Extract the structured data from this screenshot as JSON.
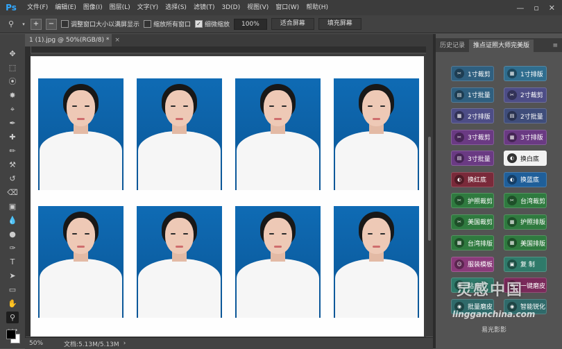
{
  "app": {
    "logo": "Ps"
  },
  "menu": [
    "文件(F)",
    "编辑(E)",
    "图像(I)",
    "图层(L)",
    "文字(Y)",
    "选择(S)",
    "滤镜(T)",
    "3D(D)",
    "视图(V)",
    "窗口(W)",
    "帮助(H)"
  ],
  "window_controls": {
    "minimize": "—",
    "restore": "▫",
    "close": "✕"
  },
  "options": {
    "zoom_in": "+",
    "zoom_out": "−",
    "resize_windows": "调整窗口大小以满屏显示",
    "zoom_all_windows": "缩放所有窗口",
    "scrubby_zoom": "细微缩放",
    "zoom_value": "100%",
    "fit_screen": "适合屏幕",
    "fill_screen": "填充屏幕"
  },
  "document": {
    "tab_title": "1 (1).jpg @ 50%(RGB/8) *",
    "close": "×"
  },
  "status": {
    "zoom": "50%",
    "doc_size": "文档:5.13M/5.13M",
    "arrow": "›"
  },
  "photos_count": 8,
  "panel": {
    "tabs": [
      "历史记录",
      "推点证照大师完美版"
    ],
    "menu_icon": "≡",
    "buttons": [
      {
        "label": "1寸裁剪",
        "color": "#2f5f7f"
      },
      {
        "label": "1寸排版",
        "color": "#2f6d8e"
      },
      {
        "label": "1寸批量",
        "color": "#2f5f7f"
      },
      {
        "label": "2寸裁剪",
        "color": "#4d4d86"
      },
      {
        "label": "2寸排版",
        "color": "#4d4d86"
      },
      {
        "label": "2寸批量",
        "color": "#3f4d7a"
      },
      {
        "label": "3寸裁剪",
        "color": "#6a3a83"
      },
      {
        "label": "3寸排版",
        "color": "#6a3a83"
      },
      {
        "label": "3寸批量",
        "color": "#6a3a83"
      },
      {
        "label": "换白底",
        "color": "#f2f2f2"
      },
      {
        "label": "换红底",
        "color": "#7a2a3a"
      },
      {
        "label": "换蓝底",
        "color": "#1f5f9a"
      },
      {
        "label": "护照裁剪",
        "color": "#2f7a3f"
      },
      {
        "label": "台湾裁剪",
        "color": "#2f7a3f"
      },
      {
        "label": "美国裁剪",
        "color": "#2f7a3f"
      },
      {
        "label": "护照排版",
        "color": "#2f7a3f"
      },
      {
        "label": "台湾排版",
        "color": "#2f7a3f"
      },
      {
        "label": "美国排版",
        "color": "#2f7a3f"
      },
      {
        "label": "服装模板",
        "color": "#8a3a7a"
      },
      {
        "label": "复 制",
        "color": "#2f7a6a"
      },
      {
        "label": "粘 贴",
        "color": "#2f7a6a"
      },
      {
        "label": "一键磨皮",
        "color": "#7a2a5a"
      },
      {
        "label": "批量磨皮",
        "color": "#2f6a6a"
      },
      {
        "label": "智能锐化",
        "color": "#2f6a6a"
      }
    ]
  },
  "watermark": {
    "logo_text": "灵感中国",
    "url": "lingganchina.com",
    "sub": "易光影影"
  }
}
